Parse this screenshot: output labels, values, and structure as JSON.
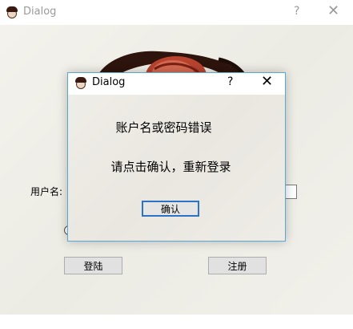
{
  "main_window": {
    "title": "Dialog",
    "help_glyph": "?",
    "close_glyph": "✕",
    "icon": "app-logo-icon",
    "form": {
      "username_label": "用户名:",
      "login_label": "登陆",
      "register_label": "注册"
    }
  },
  "dialog": {
    "title": "Dialog",
    "help_glyph": "?",
    "close_glyph": "✕",
    "message_line_1": "账户名或密码错误",
    "message_line_2": "请点击确认，重新登录",
    "confirm_label": "确认"
  },
  "colors": {
    "dialog_border": "#5aa6d6",
    "focus_border": "#2c73c4",
    "logo_dark": "#3a1a10",
    "logo_red": "#c0392b"
  }
}
